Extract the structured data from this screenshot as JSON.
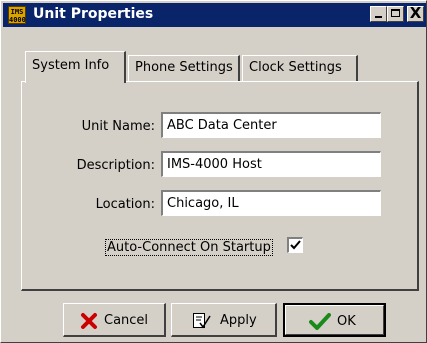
{
  "window": {
    "title": "Unit Properties",
    "app_icon_text": "IMS 4000",
    "controls": {
      "minimize": "_",
      "maximize": "□",
      "close": "X"
    }
  },
  "tabs": [
    {
      "label": "System Info",
      "active": true
    },
    {
      "label": "Phone Settings",
      "active": false
    },
    {
      "label": "Clock Settings",
      "active": false
    }
  ],
  "fields": {
    "unit_name": {
      "label": "Unit Name:",
      "value": "ABC Data Center"
    },
    "description": {
      "label": "Description:",
      "value": "IMS-4000 Host"
    },
    "location": {
      "label": "Location:",
      "value": "Chicago, IL"
    }
  },
  "auto_connect": {
    "label": "Auto-Connect On Startup",
    "checked": true
  },
  "buttons": {
    "cancel": {
      "label": "Cancel",
      "icon": "red-x-icon"
    },
    "apply": {
      "label": "Apply",
      "icon": "apply-document-icon"
    },
    "ok": {
      "label": "OK",
      "icon": "green-checkmark-icon"
    }
  },
  "colors": {
    "titlebar": "#0a246a",
    "face": "#d4d0c8",
    "cancel_icon": "#cc0000",
    "ok_icon": "#1a8a1a"
  }
}
